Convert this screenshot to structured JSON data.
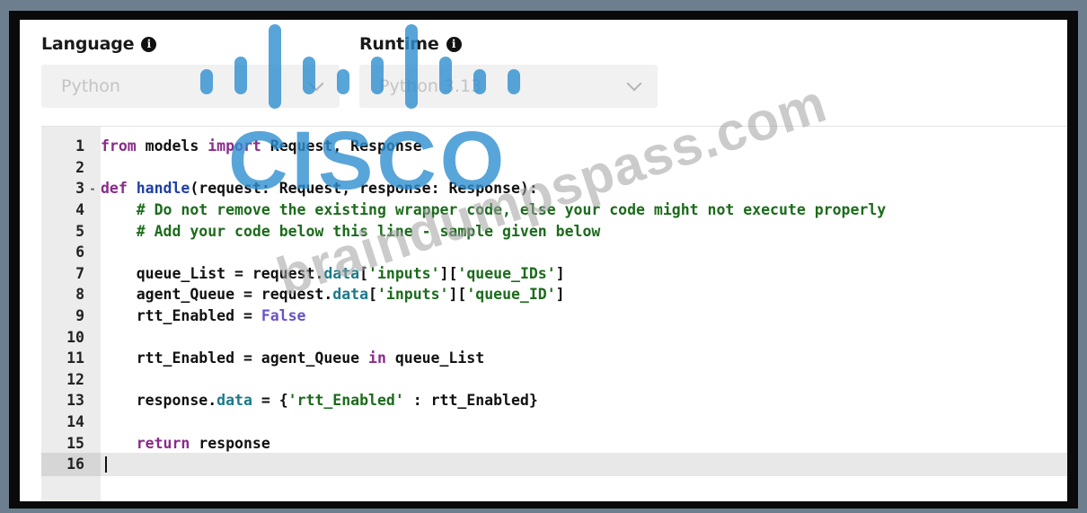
{
  "form": {
    "language_label": "Language",
    "language_value": "Python",
    "runtime_label": "Runtime",
    "runtime_value": "Python 3.13",
    "info_glyph": "i"
  },
  "editor": {
    "active_line": 16,
    "lines": [
      {
        "n": "1",
        "fold": "",
        "tokens": [
          [
            "kw",
            "from"
          ],
          [
            "code",
            " models "
          ],
          [
            "kw",
            "import"
          ],
          [
            "code",
            " Request, Response"
          ]
        ]
      },
      {
        "n": "2",
        "fold": "",
        "tokens": []
      },
      {
        "n": "3",
        "fold": "-",
        "tokens": [
          [
            "kw",
            "def"
          ],
          [
            "code",
            " "
          ],
          [
            "fn",
            "handle"
          ],
          [
            "code",
            "(request: Request, response: Response):"
          ]
        ]
      },
      {
        "n": "4",
        "fold": "",
        "tokens": [
          [
            "code",
            "    "
          ],
          [
            "cmt",
            "# Do not remove the existing wrapper code, else your code might not execute properly"
          ]
        ]
      },
      {
        "n": "5",
        "fold": "",
        "tokens": [
          [
            "code",
            "    "
          ],
          [
            "cmt",
            "# Add your code below this line - sample given below"
          ]
        ]
      },
      {
        "n": "6",
        "fold": "",
        "tokens": []
      },
      {
        "n": "7",
        "fold": "",
        "tokens": [
          [
            "code",
            "    queue_List = request."
          ],
          [
            "attr",
            "data"
          ],
          [
            "code",
            "["
          ],
          [
            "str",
            "'inputs'"
          ],
          [
            "code",
            "]["
          ],
          [
            "str",
            "'queue_IDs'"
          ],
          [
            "code",
            "]"
          ]
        ]
      },
      {
        "n": "8",
        "fold": "",
        "tokens": [
          [
            "code",
            "    agent_Queue = request."
          ],
          [
            "attr",
            "data"
          ],
          [
            "code",
            "["
          ],
          [
            "str",
            "'inputs'"
          ],
          [
            "code",
            "]["
          ],
          [
            "str",
            "'queue_ID'"
          ],
          [
            "code",
            "]"
          ]
        ]
      },
      {
        "n": "9",
        "fold": "",
        "tokens": [
          [
            "code",
            "    rtt_Enabled = "
          ],
          [
            "const",
            "False"
          ]
        ]
      },
      {
        "n": "10",
        "fold": "",
        "tokens": []
      },
      {
        "n": "11",
        "fold": "",
        "tokens": [
          [
            "code",
            "    rtt_Enabled = agent_Queue "
          ],
          [
            "kw",
            "in"
          ],
          [
            "code",
            " queue_List"
          ]
        ]
      },
      {
        "n": "12",
        "fold": "",
        "tokens": []
      },
      {
        "n": "13",
        "fold": "",
        "tokens": [
          [
            "code",
            "    response."
          ],
          [
            "attr",
            "data"
          ],
          [
            "code",
            " = {"
          ],
          [
            "str",
            "'rtt_Enabled'"
          ],
          [
            "code",
            " : rtt_Enabled}"
          ]
        ]
      },
      {
        "n": "14",
        "fold": "",
        "tokens": []
      },
      {
        "n": "15",
        "fold": "",
        "tokens": [
          [
            "code",
            "    "
          ],
          [
            "kw",
            "return"
          ],
          [
            "code",
            " response"
          ]
        ]
      },
      {
        "n": "16",
        "fold": "",
        "tokens": []
      }
    ]
  },
  "watermark": {
    "logo_text": "CISCO",
    "site_text": "braindumpspass.com"
  },
  "colors": {
    "cisco_blue": "#2f8fd0"
  }
}
